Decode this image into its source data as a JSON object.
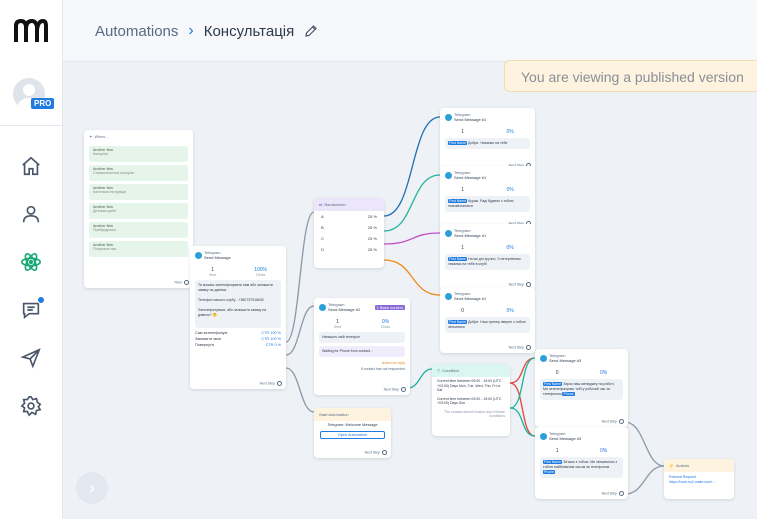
{
  "header": {
    "breadcrumb_root": "Automations",
    "breadcrumb_current": "Консультація",
    "banner": "You are viewing a published version"
  },
  "sidebar": {
    "pro_badge": "PRO"
  },
  "canvas": {
    "trigger": {
      "title": "When...",
      "items": [
        {
          "label": "Another flow",
          "sub": "Консульт"
        },
        {
          "label": "Another flow",
          "sub": "Стоматологічна консульт"
        },
        {
          "label": "Another flow",
          "sub": "Котельна Інструкція"
        },
        {
          "label": "Another flow",
          "sub": "Детская щебе"
        },
        {
          "label": "Another flow",
          "sub": "Пребуцаркотс"
        },
        {
          "label": "Another flow",
          "sub": "Получили лис"
        }
      ],
      "then": "Then"
    },
    "send_main": {
      "channel": "Telegram",
      "title": "Send Message",
      "sent": "1",
      "sent_label": "Sent",
      "opened": "100%",
      "opened_label": "Clicks",
      "text": "Ти можеш зателефонувати нам або залишити заявку на дзвінок\n\nТелефон нашого клубу - +380737916632\n\nЗателефонувати, або залишити заявку на дзвінок? 🤔",
      "buttons": [
        {
          "label": "Сам зателефоную",
          "ctr": "CTR 100 %"
        },
        {
          "label": "Замовити звон",
          "ctr": "CTR 100 %"
        },
        {
          "label": "Повернути",
          "ctr": "CTR 0 %"
        }
      ],
      "next": "Next Step"
    },
    "randomizer": {
      "title": "Randomizer",
      "rows": [
        {
          "label": "A",
          "pct": "25 %"
        },
        {
          "label": "B",
          "pct": "25 %"
        },
        {
          "label": "C",
          "pct": "25 %"
        },
        {
          "label": "D",
          "pct": "25 %"
        }
      ]
    },
    "send2": {
      "channel": "Telegram",
      "title": "Send Message #2",
      "badge": "1 Base context",
      "sent": "1",
      "sent_label": "Sent",
      "opened": "0%",
      "opened_label": "Clicks",
      "prompt": "Напишіть свій телефон",
      "wait": "Waiting for Phone from contact...",
      "action": "Action on reply",
      "no_reply": "If contact has not responded",
      "next": "Next Step"
    },
    "start_automation": {
      "title": "Start Automation",
      "sub": "Telegram: Welcome Message",
      "button": "Open Automation",
      "next": "Next Step"
    },
    "messages": [
      {
        "channel": "Telegram",
        "title": "Send Message #1",
        "sent": "1",
        "opened": "0%",
        "first": "First Name",
        "text": "Добре. Чекаємо на тебе",
        "next": "Next Step"
      },
      {
        "channel": "Telegram",
        "title": "Send Message #1",
        "sent": "1",
        "opened": "0%",
        "first": "First Name",
        "text": "Кураж. Раді будемо з тобою познайомитися",
        "next": "Next Step"
      },
      {
        "channel": "Telegram",
        "title": "Send Message #1",
        "sent": "1",
        "opened": "0%",
        "first": "First Name",
        "text": "На які дні зручно. З нетерпінням чекаємо на тебе в клубі",
        "next": "Next Step"
      },
      {
        "channel": "Telegram",
        "title": "Send Message #1",
        "sent": "0",
        "opened": "0%",
        "first": "First Name",
        "text": "Добре. Наш тренер зверне з тобою зв'язатися",
        "next": "Next Step"
      }
    ],
    "condition": {
      "title": "Condition",
      "cond1": "Current time between 09:00 - 19:00 (UTC +03:00) Days Mon, Tue, Wed, Thu, Fri or Sat",
      "cond2": "Current time between 09:00 - 19:00 (UTC +03:00) Days Sun",
      "else": "The contact doesn't match any of these conditions"
    },
    "msg_right": [
      {
        "channel": "Telegram",
        "title": "Send Message #3",
        "sent": "0",
        "opened": "0%",
        "first": "First Name",
        "text": "Зараз наш менеджер на роботі. Ми зателефонуємо тобі у робочий час за телефоном",
        "chip": "Phone",
        "next": "Next Step"
      },
      {
        "channel": "Telegram",
        "title": "Send Message #3",
        "sent": "1",
        "opened": "0%",
        "first": "First Name",
        "text": "Зв'язок з тобою. Ми зв'яжемося з тобою найближчим часом за телефоном",
        "chip": "Phone",
        "next": "Next Step"
      }
    ],
    "actions": {
      "title": "Actions",
      "text": "External Request https://hook.eu2.make.com/..."
    }
  },
  "colors": {
    "accent": "#1f7be0",
    "green": "#17a974",
    "wire_blue": "#1f6fb0",
    "wire_teal": "#1fb39a",
    "wire_pink": "#c04ec9",
    "wire_orange": "#f08a1c",
    "wire_red": "#e0483c",
    "wire_gray": "#8b98a8"
  }
}
